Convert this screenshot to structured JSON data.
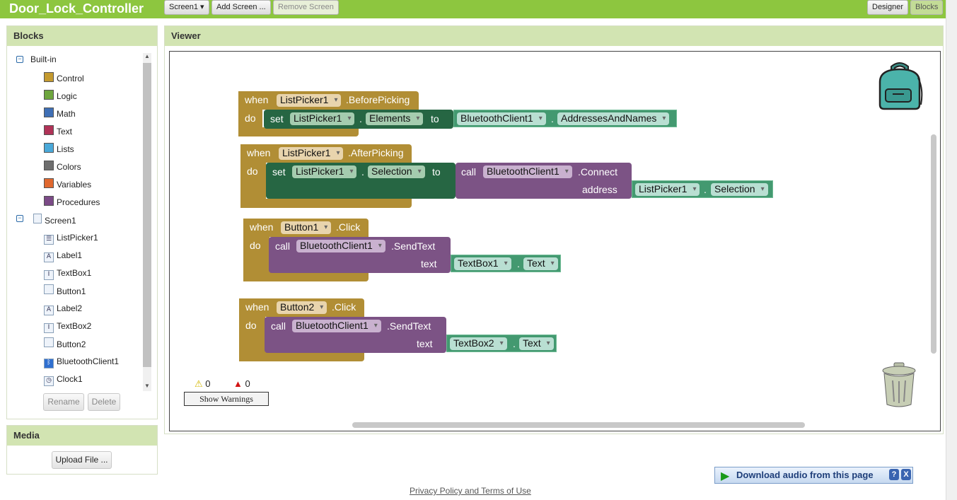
{
  "header": {
    "app_title": "Door_Lock_Controller",
    "screen_select": "Screen1 ▾",
    "add_screen": "Add Screen ...",
    "remove_screen": "Remove Screen",
    "designer": "Designer",
    "blocks": "Blocks"
  },
  "blocks_panel": {
    "title": "Blocks",
    "builtin_label": "Built-in",
    "builtin_items": [
      {
        "label": "Control",
        "color": "#c49a2f"
      },
      {
        "label": "Logic",
        "color": "#6ea63e"
      },
      {
        "label": "Math",
        "color": "#3f6fb5"
      },
      {
        "label": "Text",
        "color": "#b03257"
      },
      {
        "label": "Lists",
        "color": "#4aa9d9"
      },
      {
        "label": "Colors",
        "color": "#6e6e6e"
      },
      {
        "label": "Variables",
        "color": "#e0682f"
      },
      {
        "label": "Procedures",
        "color": "#7b4a87"
      }
    ],
    "screen_label": "Screen1",
    "components": [
      {
        "label": "ListPicker1",
        "icon": "listpicker-icon"
      },
      {
        "label": "Label1",
        "icon": "label-icon"
      },
      {
        "label": "TextBox1",
        "icon": "textbox-icon"
      },
      {
        "label": "Button1",
        "icon": "button-icon"
      },
      {
        "label": "Label2",
        "icon": "label-icon"
      },
      {
        "label": "TextBox2",
        "icon": "textbox-icon"
      },
      {
        "label": "Button2",
        "icon": "button-icon"
      },
      {
        "label": "BluetoothClient1",
        "icon": "bluetooth-icon"
      },
      {
        "label": "Clock1",
        "icon": "clock-icon"
      }
    ],
    "rename": "Rename",
    "delete": "Delete"
  },
  "media_panel": {
    "title": "Media",
    "upload": "Upload File ..."
  },
  "viewer": {
    "title": "Viewer",
    "kw_when": "when",
    "kw_do": "do",
    "kw_set": "set",
    "kw_to": "to",
    "kw_call": "call",
    "kw_dot": ".",
    "b1": {
      "component": "ListPicker1",
      "event": ".BeforePicking",
      "set_comp": "ListPicker1",
      "set_prop": "Elements",
      "val_comp": "BluetoothClient1",
      "val_prop": "AddressesAndNames"
    },
    "b2": {
      "component": "ListPicker1",
      "event": ".AfterPicking",
      "set_comp": "ListPicker1",
      "set_prop": "Selection",
      "call_comp": "BluetoothClient1",
      "method": ".Connect",
      "arg": "address",
      "arg_comp": "ListPicker1",
      "arg_prop": "Selection"
    },
    "b3": {
      "component": "Button1",
      "event": ".Click",
      "call_comp": "BluetoothClient1",
      "method": ".SendText",
      "arg": "text",
      "arg_comp": "TextBox1",
      "arg_prop": "Text"
    },
    "b4": {
      "component": "Button2",
      "event": ".Click",
      "call_comp": "BluetoothClient1",
      "method": ".SendText",
      "arg": "text",
      "arg_comp": "TextBox2",
      "arg_prop": "Text"
    },
    "warnings_count": "0",
    "errors_count": "0",
    "show_warnings": "Show Warnings"
  },
  "footer": {
    "privacy": "Privacy Policy and Terms of Use"
  },
  "download_bar": {
    "label": "Download audio from this page",
    "help": "?",
    "close": "X"
  },
  "colors": {
    "accent": "#8dc63f",
    "event_block": "#b18e35",
    "setter_block": "#266643",
    "method_block": "#7c5385",
    "getter_block": "#439970"
  }
}
